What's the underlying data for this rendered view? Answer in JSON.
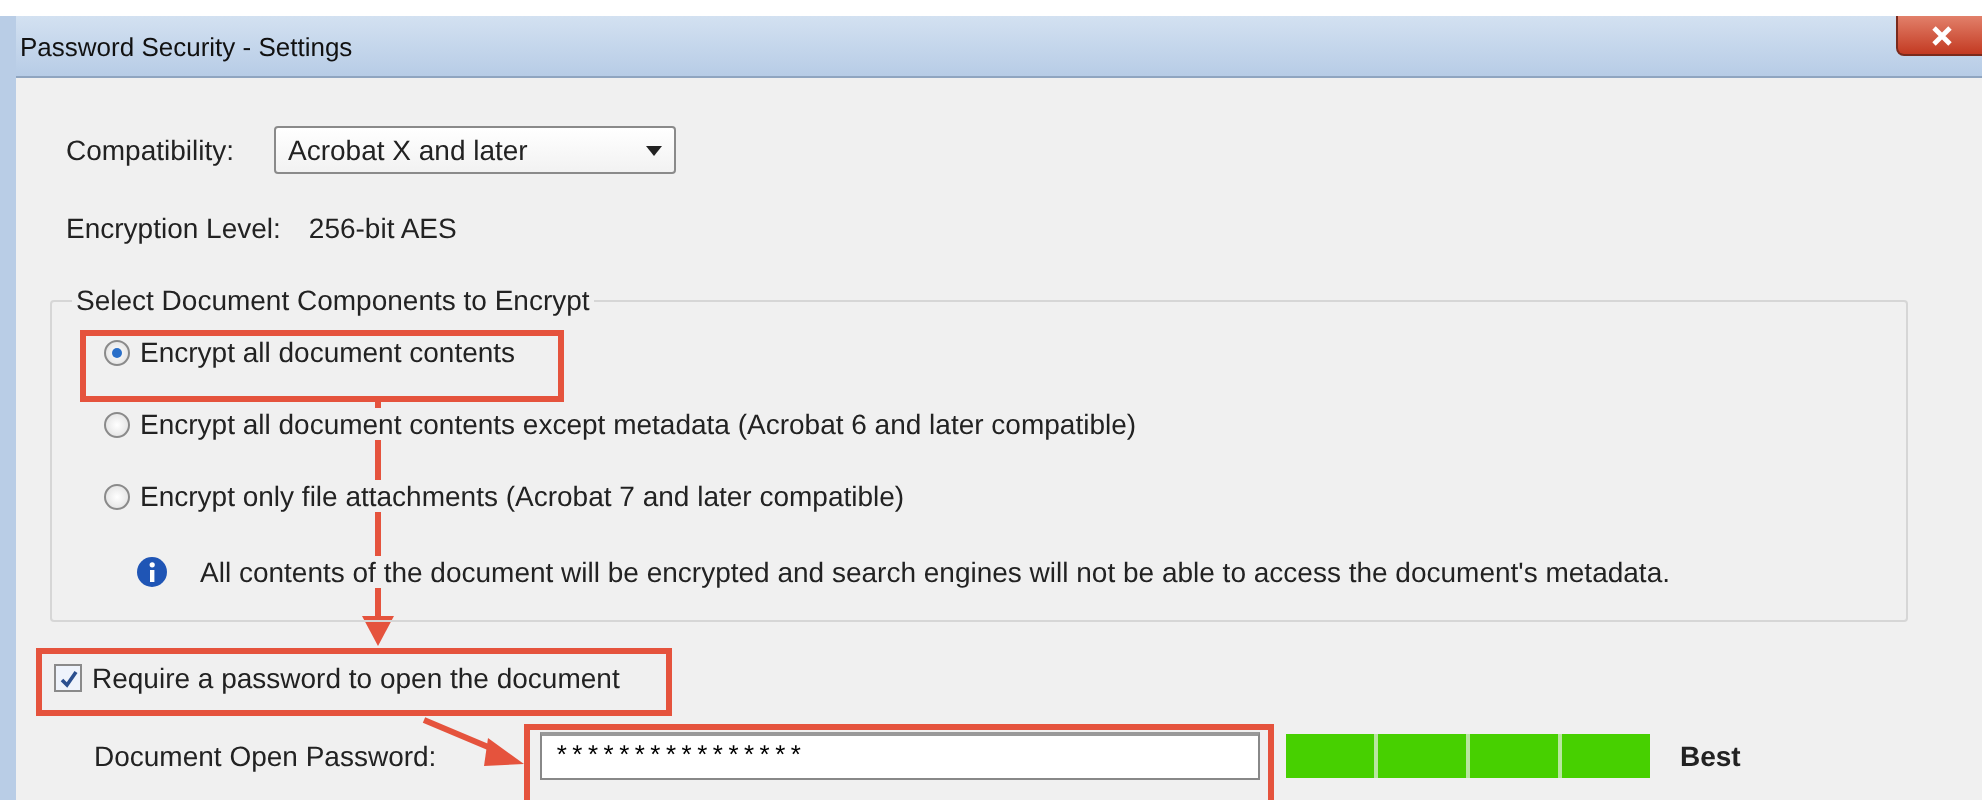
{
  "window": {
    "title": "Password Security - Settings"
  },
  "compatibility": {
    "label": "Compatibility:",
    "value": "Acrobat X and later"
  },
  "encryption_level": {
    "label": "Encryption  Level:",
    "value": "256-bit AES"
  },
  "components_group": {
    "title": "Select Document Components to Encrypt",
    "options": [
      {
        "label": "Encrypt all document contents",
        "selected": true
      },
      {
        "label": "Encrypt all document contents except metadata (Acrobat 6 and later compatible)",
        "selected": false
      },
      {
        "label": "Encrypt only file attachments (Acrobat 7 and later compatible)",
        "selected": false
      }
    ],
    "info": "All contents of the document will be encrypted and search engines will not be able to access the document's metadata."
  },
  "require_password": {
    "label": "Require a password to open the document",
    "checked": true
  },
  "open_password": {
    "label": "Document Open Password:",
    "value": "****************",
    "strength": {
      "level": 1.0,
      "reading": "Best"
    }
  }
}
